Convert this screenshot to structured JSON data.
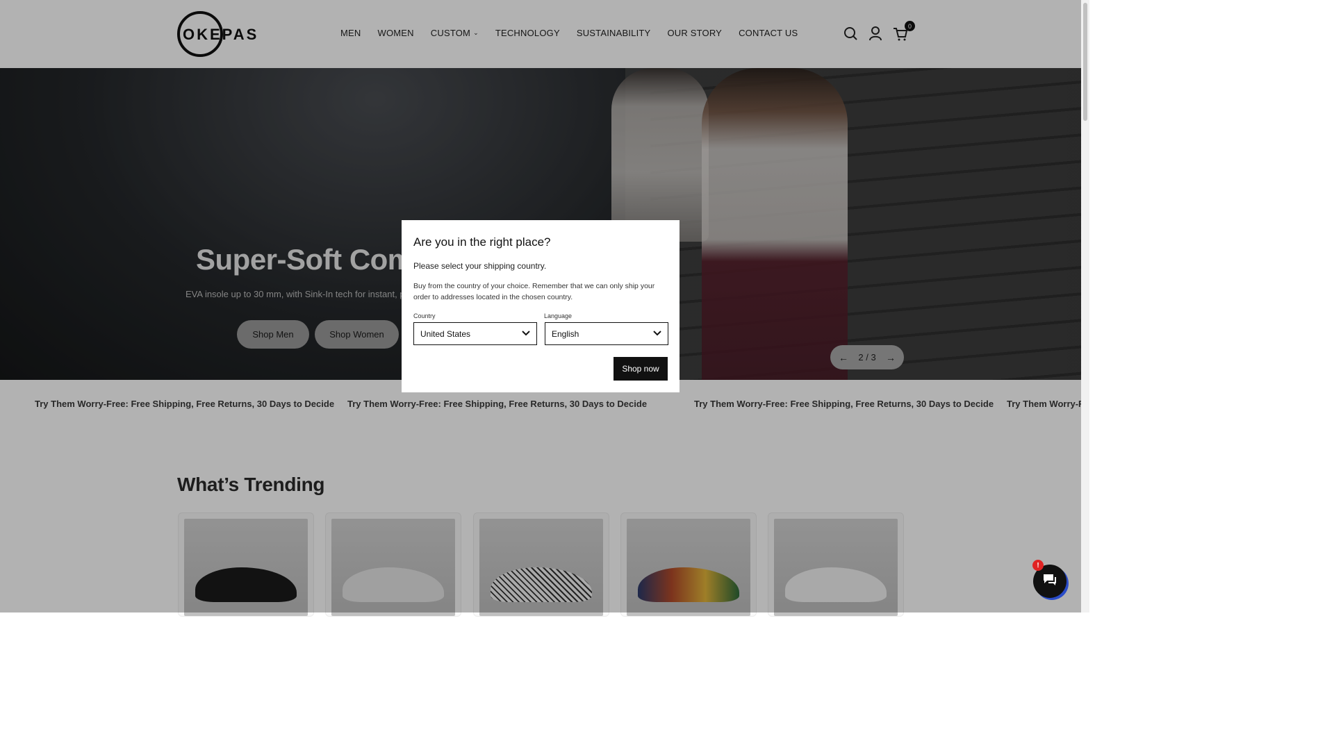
{
  "header": {
    "brand": "OKEPAS",
    "nav": [
      "MEN",
      "WOMEN",
      "CUSTOM",
      "TECHNOLOGY",
      "SUSTAINABILITY",
      "OUR STORY",
      "CONTACT US"
    ],
    "cart_count": "0"
  },
  "hero": {
    "title": "Super-Soft Comf",
    "subtitle": "EVA insole up to 30 mm, with Sink-In tech for instant, plus",
    "buttons": [
      "Shop Men",
      "Shop Women"
    ],
    "pager": {
      "current": "2",
      "separator": "/",
      "total": "3"
    }
  },
  "marquee": {
    "text": "Try Them Worry-Free: Free Shipping, Free Returns, 30 Days to Decide",
    "text_cut": "Try Them Worry-Fr"
  },
  "trending": {
    "title": "What’s Trending",
    "products": [
      {
        "name": "black-shoe",
        "color": "#1a1a1a"
      },
      {
        "name": "grey-white-shoe",
        "color": "#e6e6e6"
      },
      {
        "name": "graffiti-shoe",
        "color": "#cfcfcf"
      },
      {
        "name": "colorful-art-shoe",
        "color": "#b24a2a"
      },
      {
        "name": "white-shoe",
        "color": "#f2f2f2"
      }
    ]
  },
  "modal": {
    "title": "Are you in the right place?",
    "prompt": "Please select your shipping country.",
    "note": "Buy from the country of your choice. Remember that we can only ship your order to addresses located in the chosen country.",
    "country_label": "Country",
    "country_value": "United States",
    "language_label": "Language",
    "language_value": "English",
    "submit": "Shop now"
  },
  "chat": {
    "badge": "!"
  },
  "icons": [
    "search-icon",
    "account-icon",
    "cart-icon",
    "chevron-down-icon",
    "arrow-left-icon",
    "arrow-right-icon",
    "chat-icon"
  ]
}
